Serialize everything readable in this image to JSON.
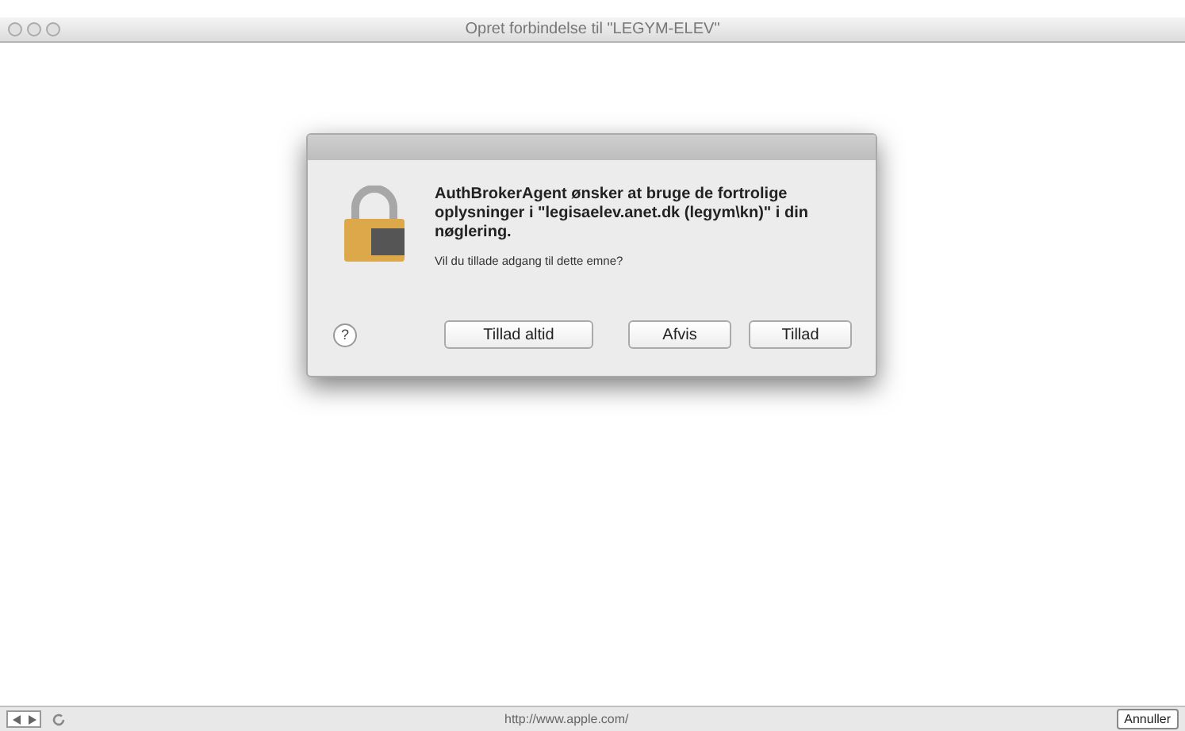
{
  "window": {
    "title": "Opret forbindelse til \"LEGYM-ELEV\""
  },
  "dialog": {
    "message": "AuthBrokerAgent ønsker at bruge de fortrolige oplysninger i \"legisaelev.anet.dk (legym\\kn)\" i din nøglering.",
    "question": "Vil du tillade adgang til dette emne?",
    "help": "?",
    "buttons": [
      {
        "label": "Tillad altid"
      },
      {
        "label": "Afvis"
      },
      {
        "label": "Tillad"
      }
    ]
  },
  "status_bar": {
    "url": "http://www.apple.com/",
    "cancel": "Annuller"
  }
}
